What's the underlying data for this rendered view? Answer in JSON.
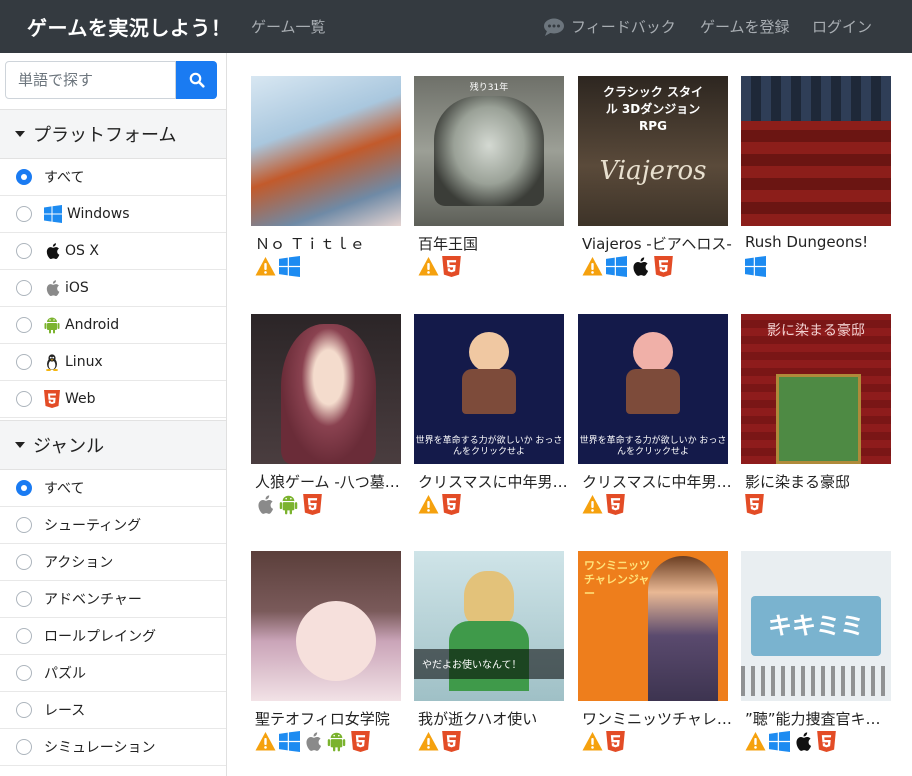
{
  "navbar": {
    "brand": "ゲームを実況しよう！",
    "games_link": "ゲーム一覧",
    "feedback_link": "フィードバック",
    "register_link": "ゲームを登録",
    "login_link": "ログイン"
  },
  "search": {
    "placeholder": "単語で探す"
  },
  "platform": {
    "heading": "プラットフォーム",
    "options": [
      {
        "label": "すべて",
        "icon": "",
        "selected": true
      },
      {
        "label": "Windows",
        "icon": "windows-icon",
        "selected": false
      },
      {
        "label": "OS X",
        "icon": "apple-icon",
        "selected": false
      },
      {
        "label": "iOS",
        "icon": "ios-icon",
        "selected": false
      },
      {
        "label": "Android",
        "icon": "android-icon",
        "selected": false
      },
      {
        "label": "Linux",
        "icon": "linux-icon",
        "selected": false
      },
      {
        "label": "Web",
        "icon": "html5-icon",
        "selected": false
      }
    ]
  },
  "genre": {
    "heading": "ジャンル",
    "options": [
      {
        "label": "すべて",
        "selected": true
      },
      {
        "label": "シューティング",
        "selected": false
      },
      {
        "label": "アクション",
        "selected": false
      },
      {
        "label": "アドベンチャー",
        "selected": false
      },
      {
        "label": "ロールプレイング",
        "selected": false
      },
      {
        "label": "パズル",
        "selected": false
      },
      {
        "label": "レース",
        "selected": false
      },
      {
        "label": "シミュレーション",
        "selected": false
      }
    ]
  },
  "games": [
    {
      "title": "Ｎｏ Ｔｉｔｌｅ",
      "platforms": [
        "warning",
        "windows"
      ],
      "thumb_text": "",
      "thumb_bg": "#c9d9e6"
    },
    {
      "title": "百年王国",
      "platforms": [
        "warning",
        "html5"
      ],
      "thumb_text": "残り31年",
      "thumb_bg": "#8a8c88"
    },
    {
      "title": "Viajeros -ビアヘロス-",
      "platforms": [
        "warning",
        "windows",
        "apple",
        "html5"
      ],
      "thumb_text": "クラシック スタイル 3Dダンジョン RPG",
      "thumb_bg": "#3a3128"
    },
    {
      "title": "Rush Dungeons!",
      "platforms": [
        "windows"
      ],
      "thumb_text": "",
      "thumb_bg": "#3d2a26"
    },
    {
      "title": "人狼ゲーム -八つ墓村-",
      "platforms": [
        "apple",
        "android",
        "html5"
      ],
      "thumb_text": "",
      "thumb_bg": "#2f2a2c"
    },
    {
      "title": "クリスマスに中年男性が",
      "platforms": [
        "warning",
        "html5"
      ],
      "thumb_text": "世界を革命する力が欲しいか おっさんをクリックせよ",
      "thumb_bg": "#141a4a"
    },
    {
      "title": "クリスマスに中年男性が",
      "platforms": [
        "warning",
        "html5"
      ],
      "thumb_text": "世界を革命する力が欲しいか おっさんをクリックせよ",
      "thumb_bg": "#141a4a"
    },
    {
      "title": "影に染まる豪邸",
      "platforms": [
        "html5"
      ],
      "thumb_text": "影に染まる豪邸",
      "thumb_bg": "#8e1c1c"
    },
    {
      "title": "聖テオフィロ女学院",
      "platforms": [
        "warning",
        "windows",
        "apple",
        "android",
        "html5"
      ],
      "thumb_text": "",
      "thumb_bg": "#6d4e4a"
    },
    {
      "title": "我が逝クハオ使い",
      "platforms": [
        "warning",
        "html5"
      ],
      "thumb_text": "やだよお使いなんて！",
      "thumb_bg": "#9fc0c6"
    },
    {
      "title": "ワンミニッツチャレンジャー",
      "platforms": [
        "warning",
        "html5"
      ],
      "thumb_text": "ワンミニッツ チャレンジャー",
      "thumb_bg": "#ee7e1c"
    },
    {
      "title": "”聴”能力捜査官キキミミ",
      "platforms": [
        "warning",
        "windows",
        "apple",
        "html5"
      ],
      "thumb_text": "キキミミ",
      "thumb_bg": "#e9eef1"
    }
  ],
  "colors": {
    "navbar": "#343a40",
    "accent": "#1a7bf2",
    "html5": "#e34c26",
    "windows": "#1d8bf1",
    "warning": "#f5a10e",
    "android": "#7bb32e"
  }
}
